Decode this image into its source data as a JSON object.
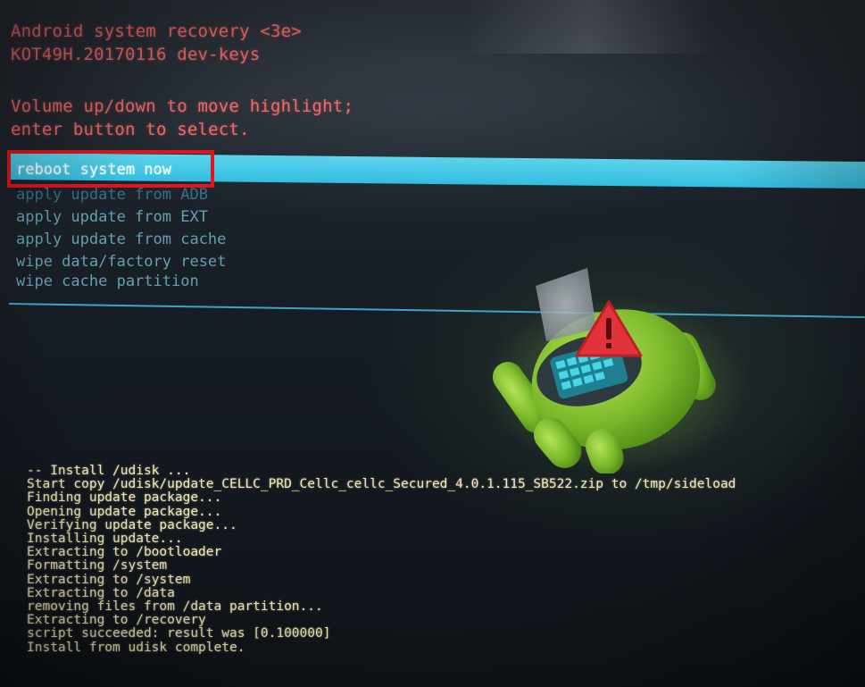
{
  "header": {
    "title": "Android system recovery <3e>",
    "build": "KOT49H.20170116 dev-keys",
    "hint_line1": "Volume up/down to move highlight;",
    "hint_line2": "enter button to select."
  },
  "menu": {
    "items": [
      {
        "label": "reboot system now",
        "selected": true
      },
      {
        "label": "apply update from ADB",
        "selected": false
      },
      {
        "label": "apply update from EXT",
        "selected": false
      },
      {
        "label": "apply update from cache",
        "selected": false
      },
      {
        "label": "wipe data/factory reset",
        "selected": false
      },
      {
        "label": "wipe cache partition",
        "selected": false
      }
    ]
  },
  "log": {
    "lines": [
      "-- Install /udisk ...",
      "Start copy /udisk/update_CELLC_PRD_Cellc_cellc_Secured_4.0.1.115_SB522.zip to /tmp/sideload",
      "Finding update package...",
      "Opening update package...",
      "Verifying update package...",
      "Installing update...",
      "Extracting to /bootloader",
      "Formatting /system",
      "Extracting to /system",
      "Extracting to /data",
      "removing files from /data partition...",
      "Extracting to /recovery",
      "script succeeded: result was [0.100000]",
      "Install from udisk complete."
    ]
  },
  "icons": {
    "robot": "android-error-robot-icon",
    "warning": "warning-triangle-icon"
  },
  "colors": {
    "header_text": "#f06a6a",
    "menu_highlight": "#3fc3e4",
    "menu_text": "#6fb7cc",
    "log_text": "#f3e7b5",
    "annotation_box": "#e0161e"
  }
}
